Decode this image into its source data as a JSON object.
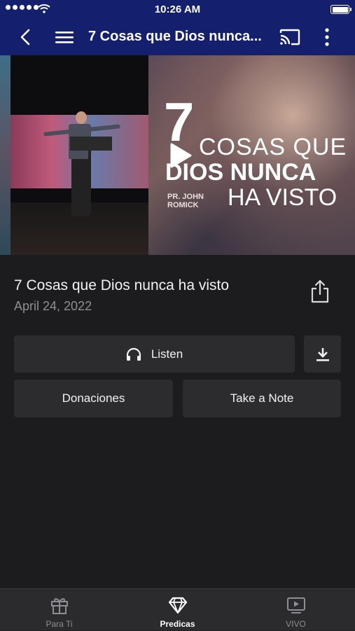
{
  "status_bar": {
    "time": "10:26 AM"
  },
  "nav": {
    "title": "7 Cosas que Dios nunca..."
  },
  "video": {
    "art_number": "7",
    "art_line1": "COSAS QUE",
    "art_line2": "DIOS NUNCA",
    "art_line3": "HA VISTO",
    "art_pastor": "PR. JOHN ROMICK"
  },
  "sermon": {
    "title": "7 Cosas que Dios nunca ha visto",
    "date": "April 24, 2022"
  },
  "actions": {
    "listen_label": "Listen",
    "donations_label": "Donaciones",
    "note_label": "Take a Note"
  },
  "tabs": [
    {
      "label": "Para Ti",
      "icon": "gift-icon",
      "active": false
    },
    {
      "label": "Predicas",
      "icon": "diamond-icon",
      "active": true
    },
    {
      "label": "VIVO",
      "icon": "tv-play-icon",
      "active": false
    }
  ],
  "colors": {
    "header": "#14206e",
    "background": "#1c1c1e",
    "button": "#2c2c2e",
    "tab_bar": "#2b2b2d"
  }
}
